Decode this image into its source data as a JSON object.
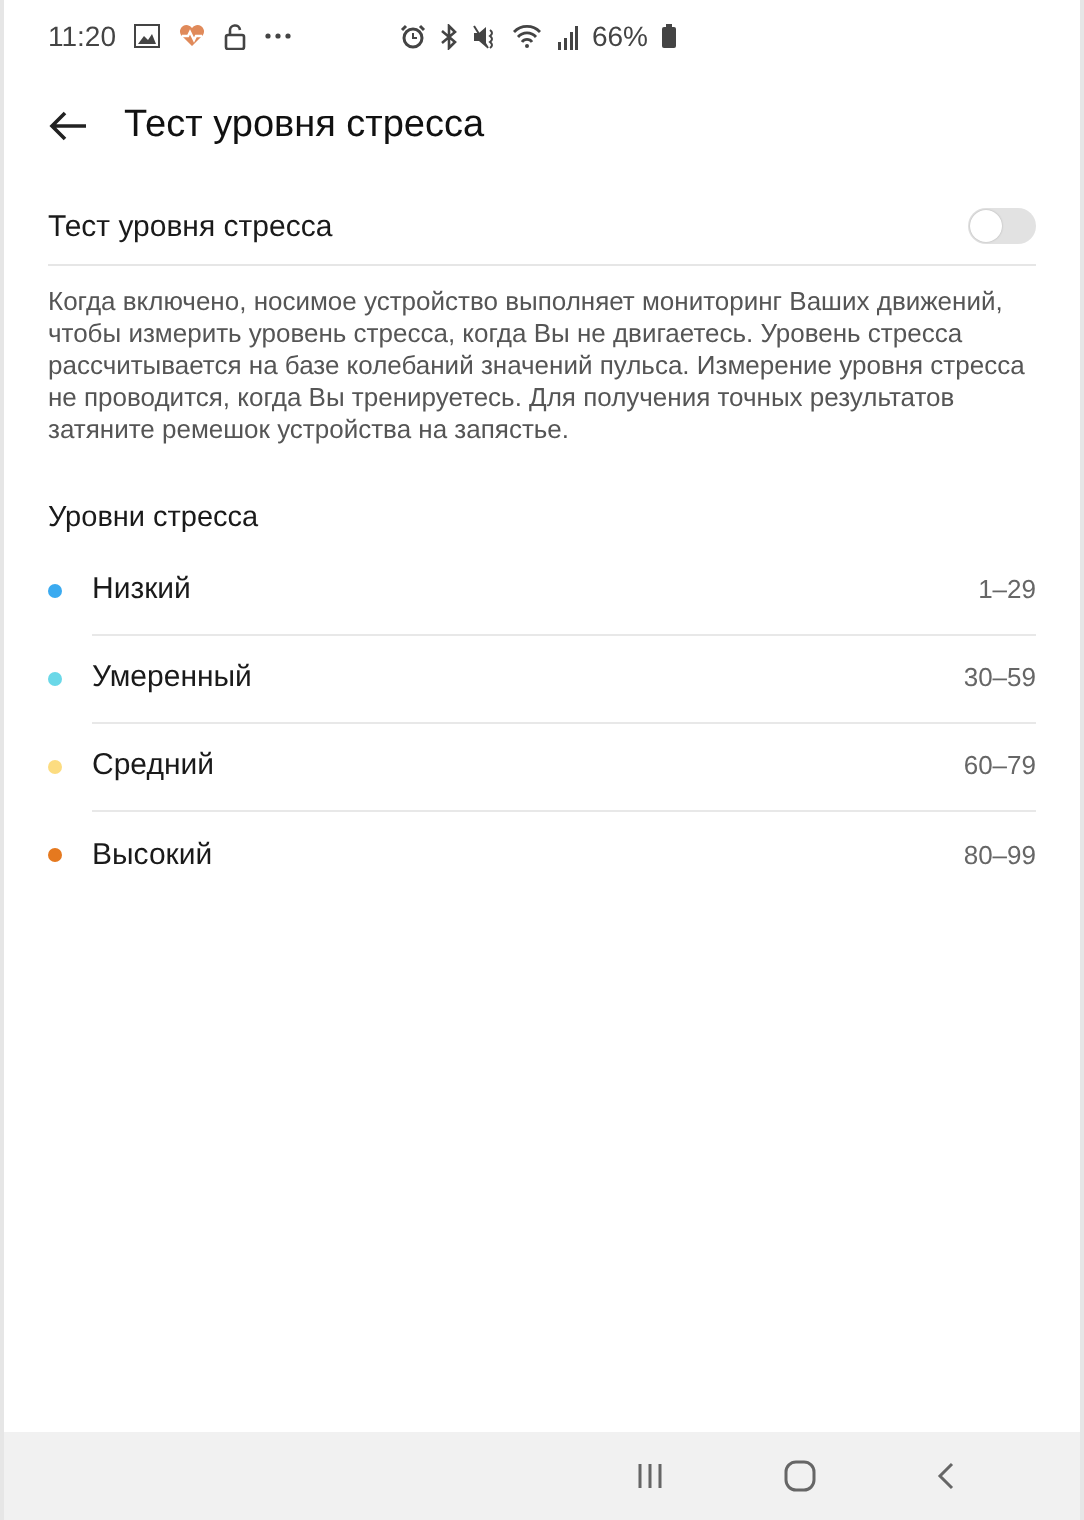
{
  "status_bar": {
    "time": "11:20",
    "battery": "66%"
  },
  "header": {
    "title": "Тест уровня стресса"
  },
  "toggle": {
    "label": "Тест уровня стресса",
    "on": false
  },
  "description": "Когда включено, носимое устройство выполняет мониторинг Ваших движений, чтобы измерить уровень стресса, когда Вы не двигаетесь. Уровень стресса рассчитывается на базе колебаний значений пульса. Измерение уровня стресса не проводится, когда Вы тренируетесь. Для получения точных результатов затяните ремешок устройства на запястье.",
  "section": {
    "title": "Уровни стресса"
  },
  "levels": [
    {
      "name": "Низкий",
      "range": "1–29",
      "color": "#3aaaf0"
    },
    {
      "name": "Умеренный",
      "range": "30–59",
      "color": "#6ad8e8"
    },
    {
      "name": "Средний",
      "range": "60–79",
      "color": "#fcdc80"
    },
    {
      "name": "Высокий",
      "range": "80–99",
      "color": "#e5791f"
    }
  ]
}
